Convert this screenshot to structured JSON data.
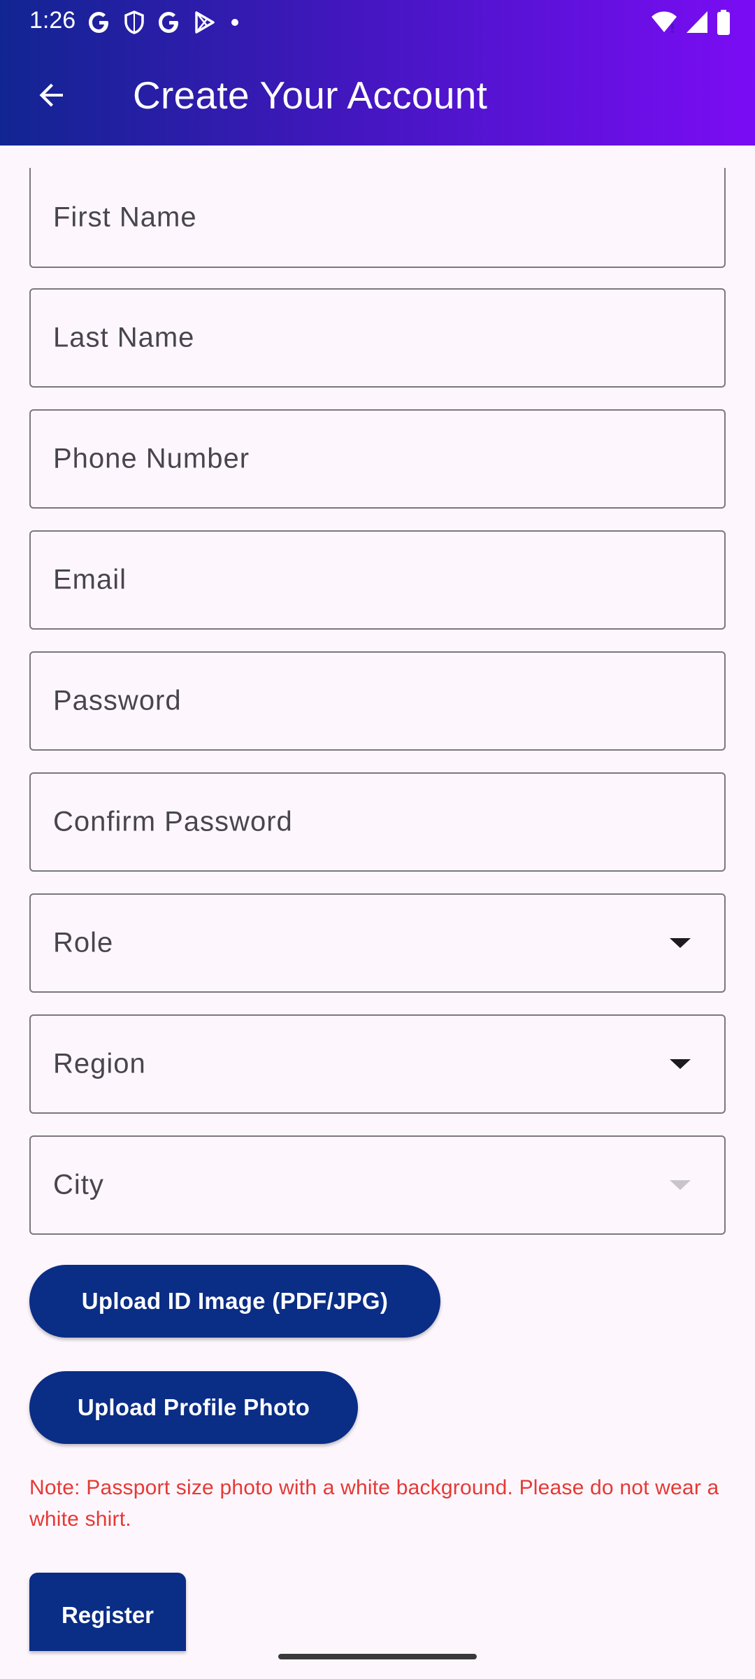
{
  "status_bar": {
    "time": "1:26",
    "left_icons": [
      "google-g-icon",
      "shield-icon",
      "google-g-icon",
      "play-icon",
      "dot-icon"
    ],
    "right_icons": [
      "wifi-icon",
      "signal-icon",
      "battery-icon"
    ]
  },
  "app_bar": {
    "title": "Create Your Account",
    "back_icon": "arrow-back-icon"
  },
  "form": {
    "first_name": "First Name",
    "last_name": "Last Name",
    "phone_number": "Phone Number",
    "email": "Email",
    "password": "Password",
    "confirm_password": "Confirm Password",
    "role": "Role",
    "region": "Region",
    "city": "City"
  },
  "buttons": {
    "upload_id": "Upload ID Image (PDF/JPG)",
    "upload_photo": "Upload Profile Photo",
    "register": "Register"
  },
  "note": "Note: Passport size photo with a white background. Please do not wear a white shirt.",
  "colors": {
    "header_gradient_start": "#112591",
    "header_gradient_end": "#7b0cf4",
    "button_primary": "#0a2d86",
    "note_red": "#e53935",
    "background": "#fdf7fd"
  }
}
